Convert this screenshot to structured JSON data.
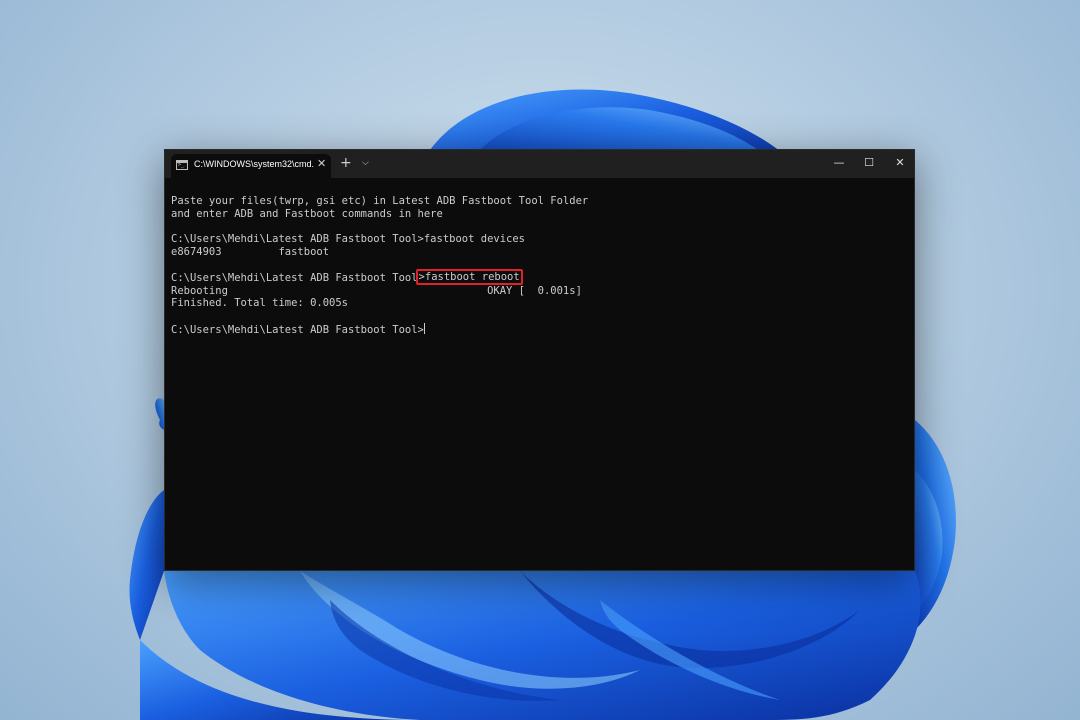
{
  "window": {
    "tab_title": "C:\\WINDOWS\\system32\\cmd.",
    "tab_close_glyph": "✕",
    "new_tab_glyph": "+",
    "dropdown_glyph": "⌵",
    "minimize_glyph": "—",
    "maximize_glyph": "☐",
    "close_glyph": "✕"
  },
  "terminal": {
    "lines": [
      "Paste your files(twrp, gsi etc) in Latest ADB Fastboot Tool Folder",
      "and enter ADB and Fastboot commands in here",
      "",
      "C:\\Users\\Mehdi\\Latest ADB Fastboot Tool>fastboot devices",
      "e8674903         fastboot",
      ""
    ],
    "reboot_prompt": "C:\\Users\\Mehdi\\Latest ADB Fastboot Tool",
    "reboot_command": ">fastboot reboot",
    "after_lines": [
      "Rebooting                                         OKAY [  0.001s]",
      "Finished. Total time: 0.005s",
      ""
    ],
    "current_prompt": "C:\\Users\\Mehdi\\Latest ADB Fastboot Tool>"
  },
  "colors": {
    "terminal_bg": "#0c0c0c",
    "terminal_text": "#cccccc",
    "titlebar_bg": "#202020",
    "highlight": "#e0212b",
    "wallpaper_blue": "#1a5fe0"
  },
  "icons": {
    "tab_icon": "cmd-icon",
    "minimize": "minimize-icon",
    "maximize": "maximize-icon",
    "close": "close-icon"
  }
}
